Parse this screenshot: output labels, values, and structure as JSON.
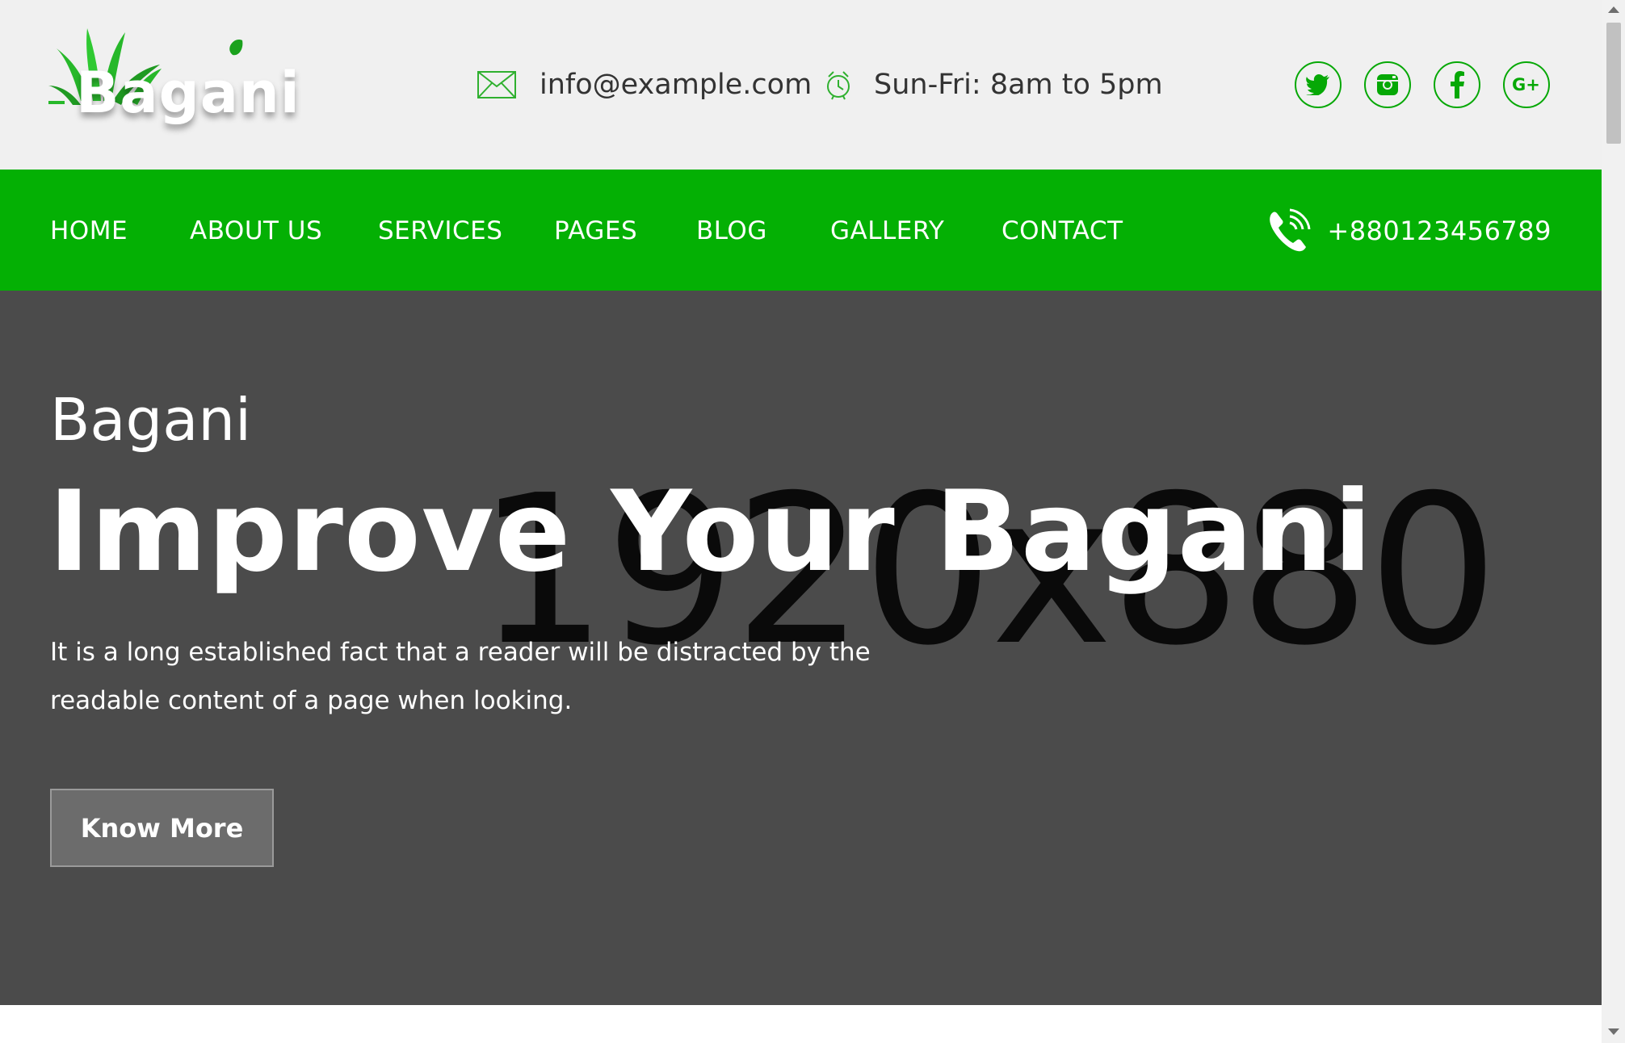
{
  "brand": {
    "name": "Bagani"
  },
  "topbar": {
    "email": "info@example.com",
    "hours": "Sun-Fri: 8am to 5pm",
    "icons": [
      "email-icon",
      "clock-icon"
    ],
    "social": [
      "twitter-icon",
      "instagram-icon",
      "facebook-icon",
      "google-plus-icon"
    ]
  },
  "nav": {
    "items": [
      "HOME",
      "ABOUT US",
      "SERVICES",
      "PAGES",
      "BLOG",
      "GALLERY",
      "CONTACT"
    ],
    "phone": "+880123456789"
  },
  "hero": {
    "placeholder_label": "1920x880",
    "subtitle": "Bagani",
    "title": "Improve Your Bagani",
    "description": "It is a long established fact that a reader will be distracted by the readable content of a page when looking.",
    "button": "Know More"
  },
  "colors": {
    "accent": "#04b004",
    "topbar_bg": "#f0f0f0",
    "hero_bg": "#4b4b4b",
    "button_bg": "#6c6c6c"
  }
}
